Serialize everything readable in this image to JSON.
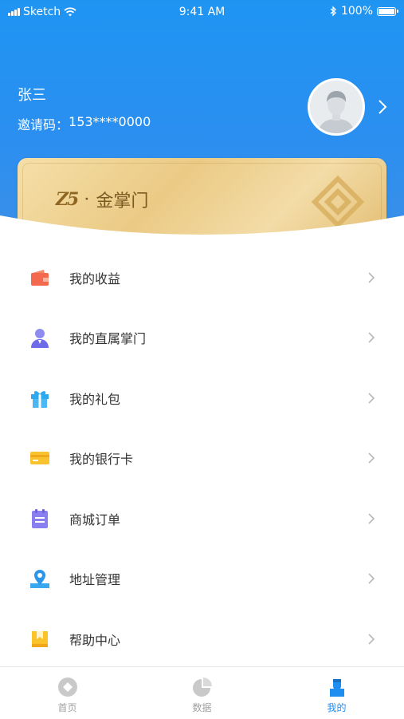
{
  "status_bar": {
    "carrier": "Sketch",
    "time": "9:41 AM",
    "battery": "100%"
  },
  "profile": {
    "name": "张三",
    "invite_label": "邀请码：",
    "invite_code": "153****0000"
  },
  "card": {
    "logo": "Z5",
    "separator": "·",
    "title": "金掌门"
  },
  "menu": [
    {
      "label": "我的收益",
      "icon": "wallet-icon"
    },
    {
      "label": "我的直属掌门",
      "icon": "person-icon"
    },
    {
      "label": "我的礼包",
      "icon": "gift-icon"
    },
    {
      "label": "我的银行卡",
      "icon": "bank-card-icon"
    },
    {
      "label": "商城订单",
      "icon": "order-clipboard-icon"
    },
    {
      "label": "地址管理",
      "icon": "location-icon"
    },
    {
      "label": "帮助中心",
      "icon": "help-book-icon"
    }
  ],
  "tabbar": [
    {
      "label": "首页",
      "icon": "home-icon",
      "active": false
    },
    {
      "label": "数据",
      "icon": "pie-chart-icon",
      "active": false
    },
    {
      "label": "我的",
      "icon": "profile-icon",
      "active": true
    }
  ],
  "colors": {
    "primary": "#1f8ef1",
    "gold": "#ebca85"
  }
}
